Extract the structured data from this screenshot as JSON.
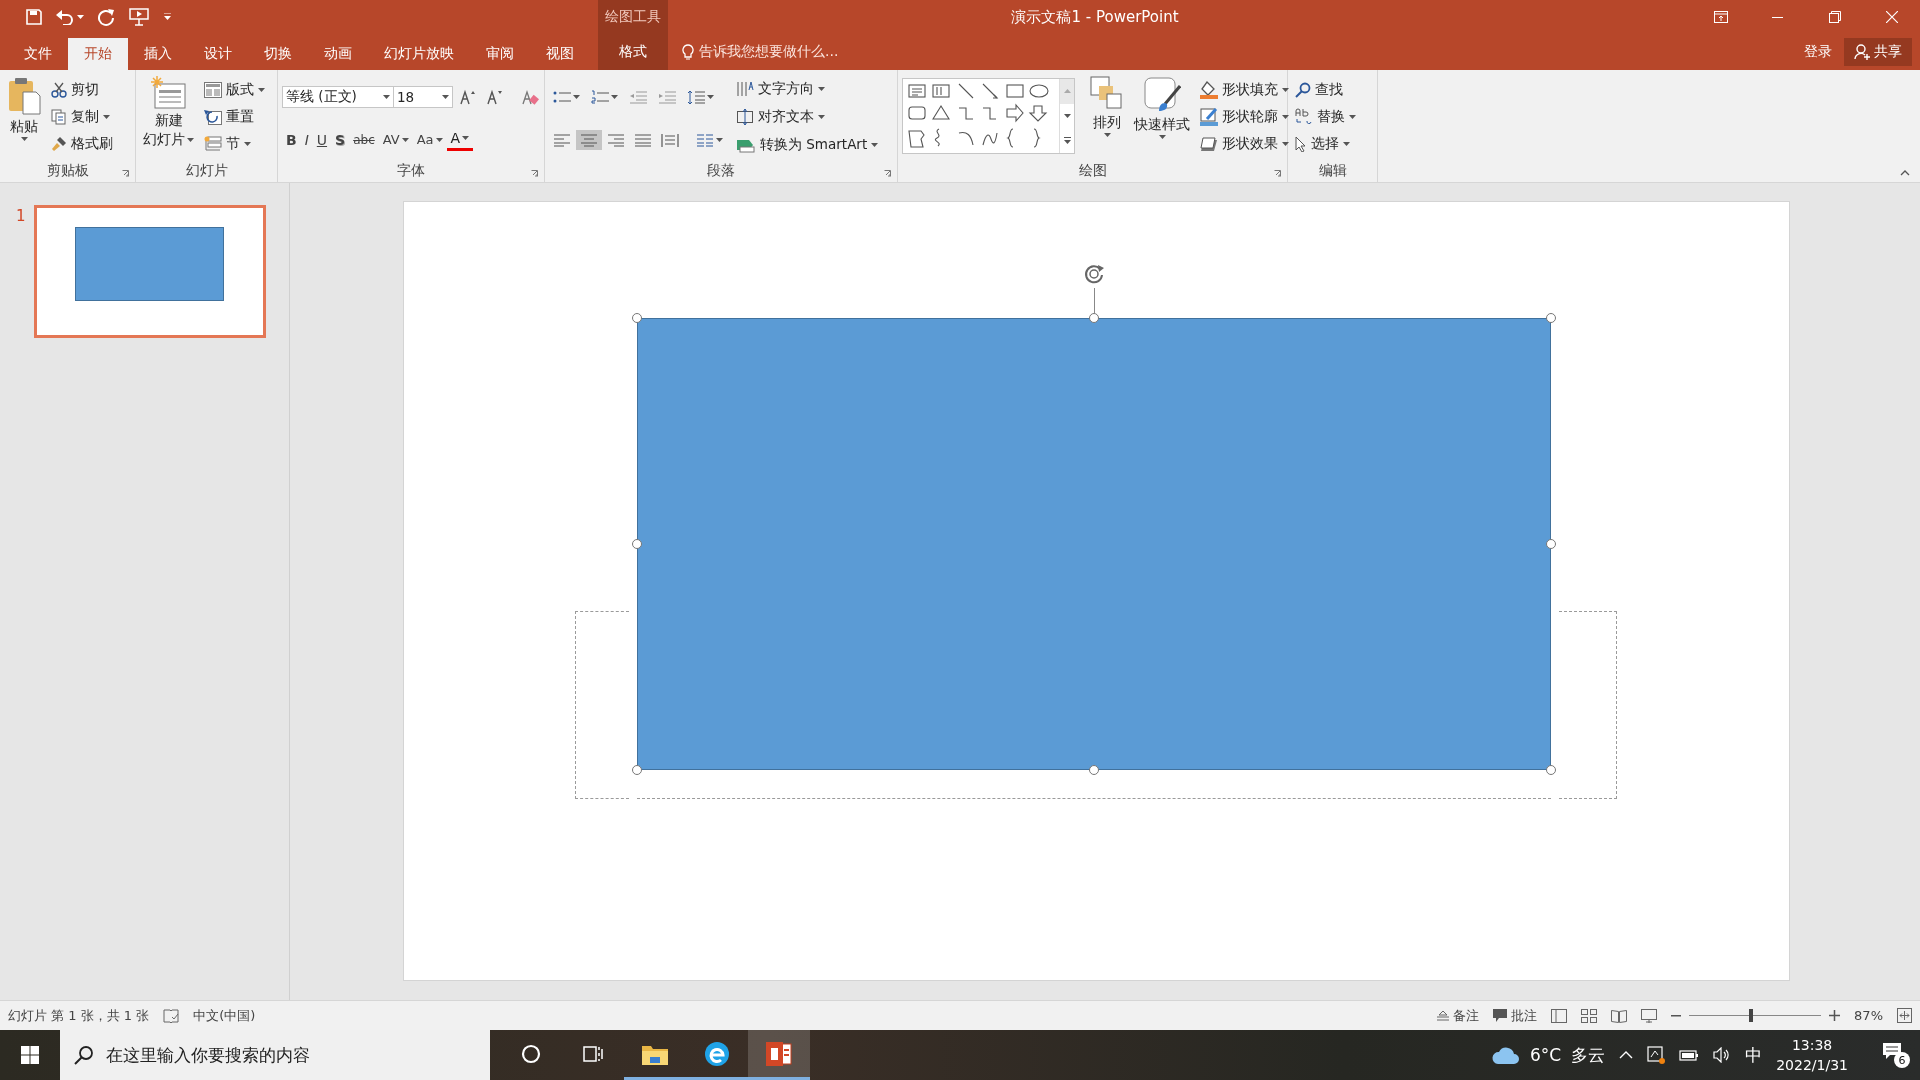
{
  "window": {
    "title": "演示文稿1 - PowerPoint",
    "tool_group": "绘图工具"
  },
  "ribbon_tabs": [
    {
      "label": "文件",
      "selected": false,
      "kind": "normal"
    },
    {
      "label": "开始",
      "selected": true,
      "kind": "normal"
    },
    {
      "label": "插入",
      "selected": false,
      "kind": "normal"
    },
    {
      "label": "设计",
      "selected": false,
      "kind": "normal"
    },
    {
      "label": "切换",
      "selected": false,
      "kind": "normal"
    },
    {
      "label": "动画",
      "selected": false,
      "kind": "normal"
    },
    {
      "label": "幻灯片放映",
      "selected": false,
      "kind": "normal"
    },
    {
      "label": "审阅",
      "selected": false,
      "kind": "normal"
    },
    {
      "label": "视图",
      "selected": false,
      "kind": "normal"
    },
    {
      "label": "格式",
      "selected": false,
      "kind": "contextual"
    }
  ],
  "tell_me": {
    "placeholder": "告诉我您想要做什么..."
  },
  "sign_in": "登录",
  "share": "共享",
  "clipboard": {
    "label": "剪贴板",
    "paste": "粘贴",
    "items": [
      "剪切",
      "复制",
      "格式刷"
    ]
  },
  "slides_group": {
    "label": "幻灯片",
    "new_slide": [
      "新建",
      "幻灯片"
    ],
    "items": [
      "版式",
      "重置",
      "节"
    ]
  },
  "font": {
    "label": "字体",
    "font_name": "等线 (正文)",
    "font_size": "18",
    "format_buttons": [
      "B",
      "I",
      "U",
      "S",
      "abc",
      "AV",
      "Aa",
      "A"
    ]
  },
  "paragraph": {
    "label": "段落",
    "alignments": [
      {
        "selected": false
      },
      {
        "selected": true
      },
      {
        "selected": false
      },
      {
        "selected": false
      },
      {
        "selected": false
      }
    ],
    "items": [
      "文字方向",
      "对齐文本",
      "转换为 SmartArt"
    ]
  },
  "drawing": {
    "label": "绘图",
    "arrange": "排列",
    "quick_styles": "快速样式",
    "items": [
      "形状填充",
      "形状轮廓",
      "形状效果"
    ]
  },
  "editing": {
    "label": "编辑",
    "items": [
      "查找",
      "替换",
      "选择"
    ]
  },
  "thumbnails": [
    {
      "number": "1",
      "selected": true
    }
  ],
  "slide": {
    "shapes": [
      {
        "kind": "placeholder",
        "selected": false
      },
      {
        "kind": "rectangle",
        "selected": true
      }
    ]
  },
  "status_bar": {
    "slide_info": "幻灯片 第 1 张，共 1 张",
    "language": "中文(中国)",
    "notes": "备注",
    "comments": "批注",
    "zoom_slider": {
      "level": 0.47
    },
    "zoom": "87%"
  },
  "taskbar": {
    "search": {
      "placeholder": "在这里输入你要搜索的内容"
    },
    "apps": [
      {
        "kind": "cortana",
        "running": false,
        "selected": false
      },
      {
        "kind": "task-view",
        "running": false,
        "selected": false
      },
      {
        "kind": "folder",
        "running": true,
        "selected": false
      },
      {
        "kind": "browser",
        "running": true,
        "selected": false
      },
      {
        "kind": "presentation",
        "running": true,
        "selected": true
      }
    ],
    "weather": {
      "temperature": "6°C",
      "condition": "多云"
    },
    "ime": "中",
    "clock": {
      "time": "13:38",
      "date": "2022/1/31"
    },
    "notifications": "6"
  }
}
